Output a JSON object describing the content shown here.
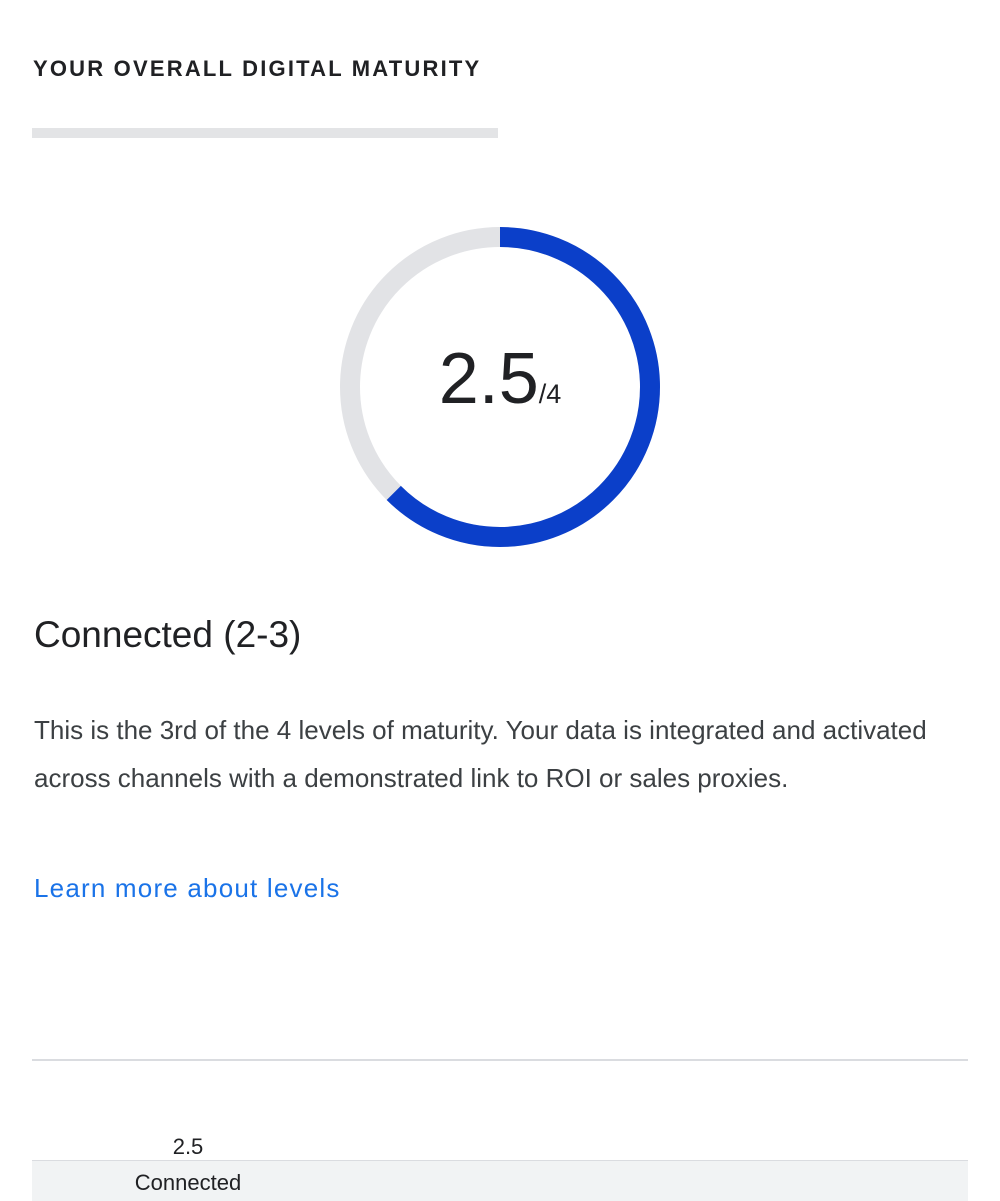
{
  "section": {
    "title": "YOUR OVERALL DIGITAL MATURITY"
  },
  "gauge": {
    "score": 2.5,
    "max": 4,
    "score_label": "2.5",
    "max_label": "/4",
    "colors": {
      "progress": "#0b3fc9",
      "track": "#e2e3e6"
    }
  },
  "level": {
    "heading": "Connected (2-3)",
    "description": "This is the 3rd of the 4 levels of maturity. Your data is integrated and activated across channels with a demonstrated link to ROI or sales proxies.",
    "link_label": "Learn more about levels",
    "link_color": "#1a73e8"
  },
  "scale": {
    "marker_value": "2.5",
    "marker_label": "Connected"
  }
}
